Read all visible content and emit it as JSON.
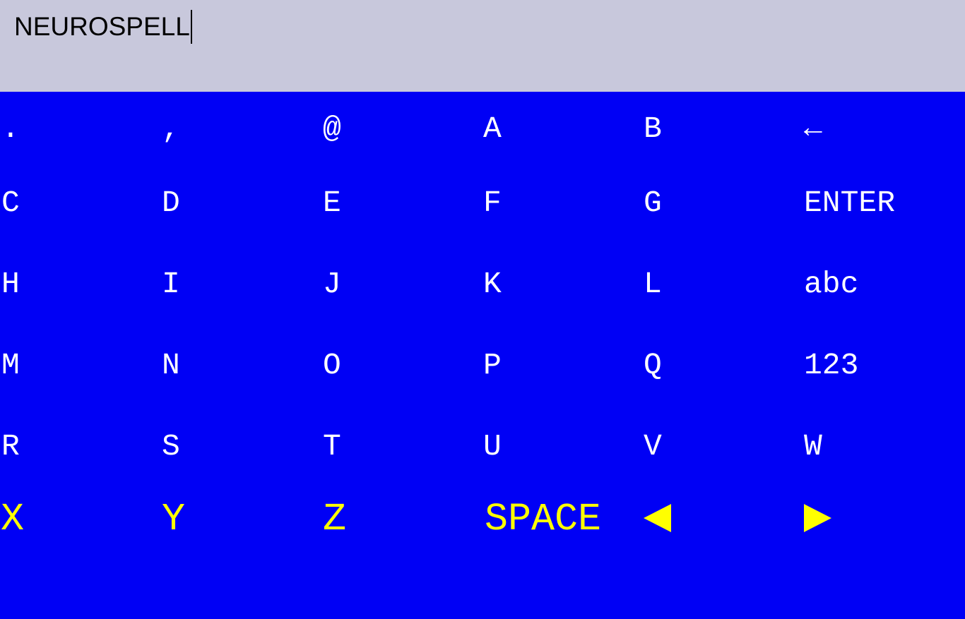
{
  "colors": {
    "text_bar_background": "#c8c8dc",
    "keyboard_background": "#0000f5",
    "key_text": "#ffffff",
    "highlighted_row_text": "#ffff00"
  },
  "text_field": {
    "value": "NEUROSPELL"
  },
  "keyboard": {
    "row1": [
      ".",
      ",",
      "@",
      "A",
      "B",
      "←"
    ],
    "row2": [
      "C",
      "D",
      "E",
      "F",
      "G",
      "ENTER"
    ],
    "row3": [
      "H",
      "I",
      "J",
      "K",
      "L",
      "abc"
    ],
    "row4": [
      "M",
      "N",
      "O",
      "P",
      "Q",
      "123"
    ],
    "row5": [
      "R",
      "S",
      "T",
      "U",
      "V",
      "W"
    ],
    "row6": [
      "X",
      "Y",
      "Z",
      "SPACE"
    ],
    "row6_icons": [
      "left-arrow-icon",
      "right-arrow-icon"
    ],
    "highlighted_row": 6
  }
}
